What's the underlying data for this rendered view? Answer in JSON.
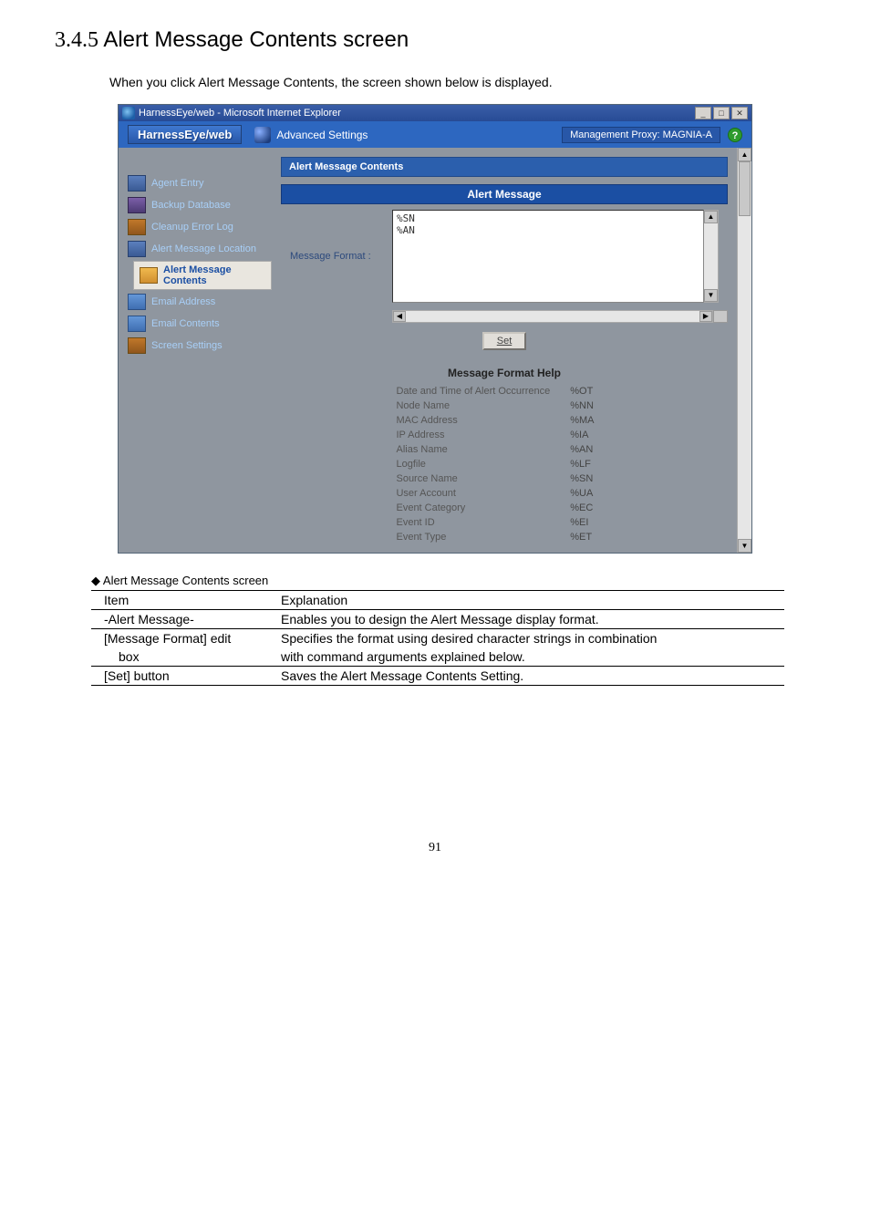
{
  "doc": {
    "section_number": "3.4.5",
    "section_title": "Alert Message Contents screen",
    "intro": "When you click Alert Message Contents, the screen shown below is displayed.",
    "page_number": "91"
  },
  "window": {
    "title": "HarnessEye/web - Microsoft Internet Explorer",
    "logo": "HarnessEye/web",
    "advanced": "Advanced Settings",
    "proxy_label": "Management Proxy: MAGNIA-A",
    "help_badge": "?"
  },
  "sidebar": {
    "items": [
      {
        "label": "Agent Entry",
        "icon": "alt4"
      },
      {
        "label": "Backup Database",
        "icon": "alt3"
      },
      {
        "label": "Cleanup Error Log",
        "icon": "alt2"
      },
      {
        "label": "Alert Message Location",
        "icon": "alt4"
      },
      {
        "label": "Alert Message Contents",
        "icon": "active",
        "active": true
      },
      {
        "label": "Email Address",
        "icon": "alt1"
      },
      {
        "label": "Email Contents",
        "icon": "alt1"
      },
      {
        "label": "Screen Settings",
        "icon": "alt2"
      }
    ]
  },
  "form": {
    "panel_title": "Alert Message Contents",
    "band_title": "Alert Message",
    "format_label": "Message Format :",
    "textarea_value": "%SN\n%AN",
    "set_button": "Set"
  },
  "help": {
    "title": "Message Format Help",
    "rows": [
      {
        "name": "Date and Time of Alert Occurrence",
        "fmt": "%OT"
      },
      {
        "name": "Node Name",
        "fmt": "%NN"
      },
      {
        "name": "MAC Address",
        "fmt": "%MA"
      },
      {
        "name": "IP Address",
        "fmt": "%IA"
      },
      {
        "name": "Alias Name",
        "fmt": "%AN"
      },
      {
        "name": "Logfile",
        "fmt": "%LF"
      },
      {
        "name": "Source Name",
        "fmt": "%SN"
      },
      {
        "name": "User Account",
        "fmt": "%UA"
      },
      {
        "name": "Event Category",
        "fmt": "%EC"
      },
      {
        "name": "Event ID",
        "fmt": "%EI"
      },
      {
        "name": "Event Type",
        "fmt": "%ET"
      }
    ]
  },
  "desc": {
    "caption": "◆ Alert Message Contents screen",
    "head_item": "Item",
    "head_explanation": "Explanation",
    "rows": [
      {
        "item": "-Alert Message-",
        "indent": 1,
        "explanation": "Enables you to design the Alert Message display format."
      },
      {
        "item": "[Message Format] edit",
        "indent": 1,
        "explanation": "Specifies the format using desired character strings in combination"
      },
      {
        "item": "box",
        "indent": 2,
        "explanation": "with command arguments explained below."
      },
      {
        "item": "[Set] button",
        "indent": 1,
        "explanation": "Saves the Alert Message Contents Setting."
      }
    ]
  }
}
